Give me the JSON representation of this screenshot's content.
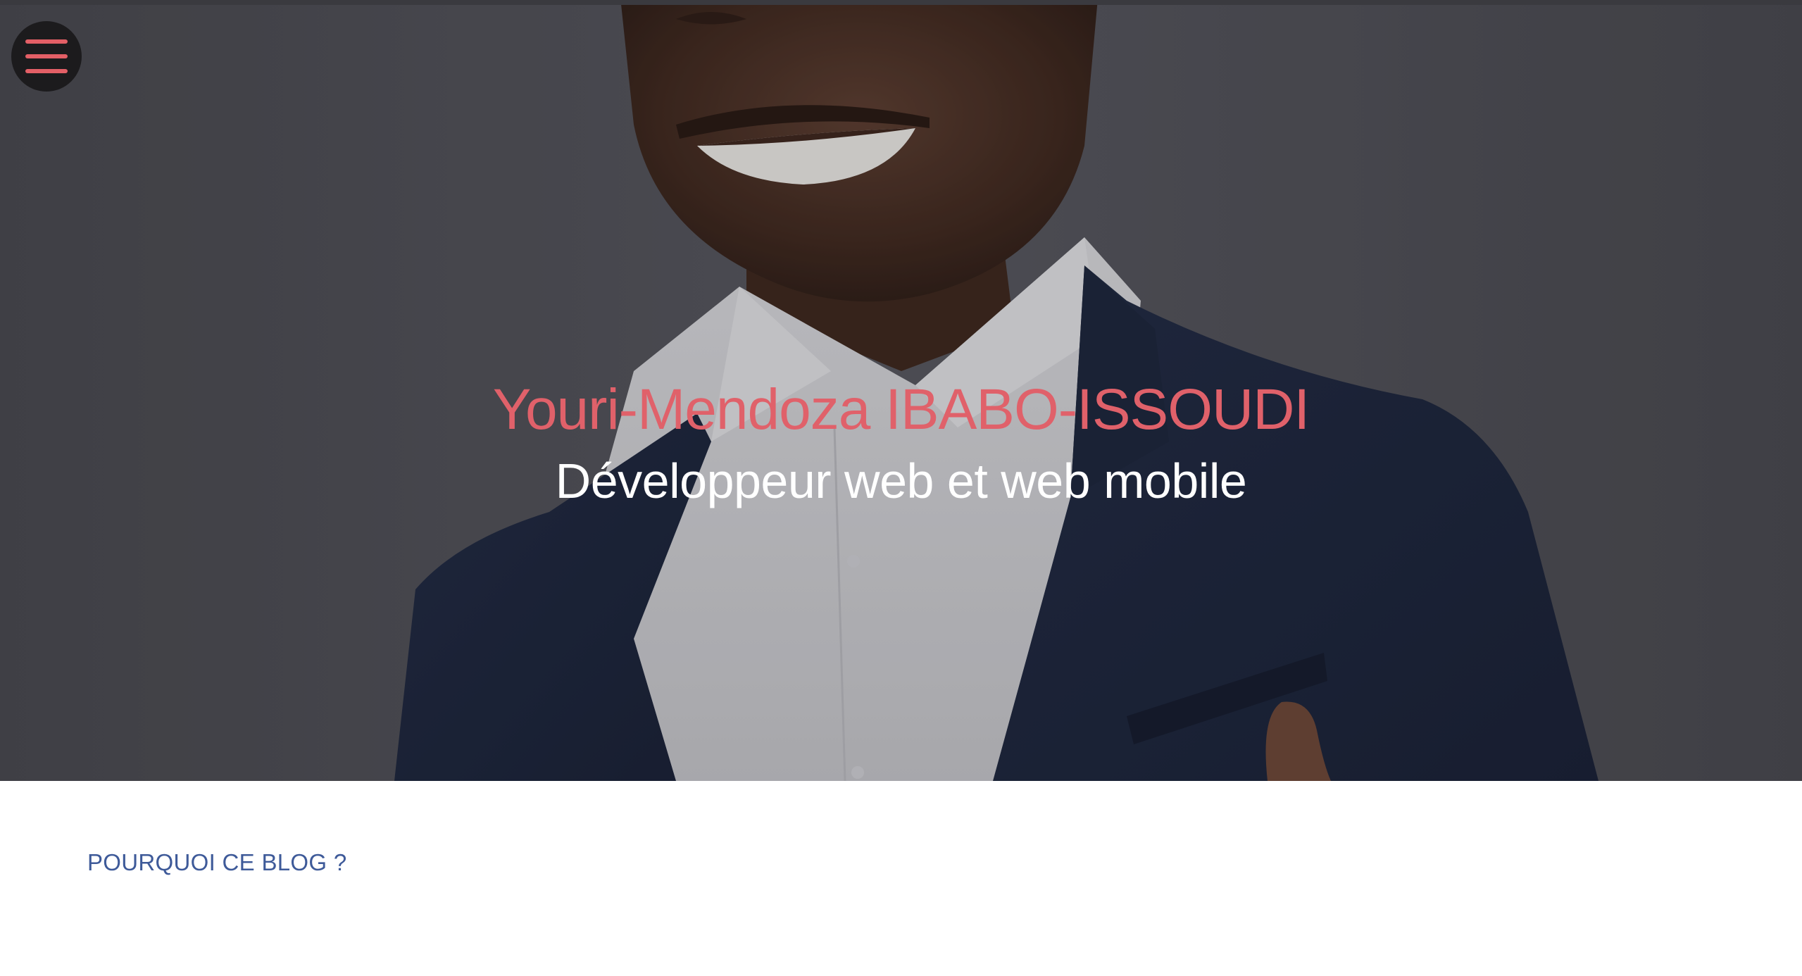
{
  "menu": {
    "icon": "hamburger-icon",
    "color": "#e35f66"
  },
  "hero": {
    "name": "Youri-Mendoza IBABO-ISSOUDI",
    "subtitle": "Développeur web et web mobile",
    "name_color": "#e0616a",
    "subtitle_color": "#ffffff"
  },
  "main": {
    "section_heading": "POURQUOI CE BLOG ?",
    "heading_color": "#3e5a99"
  }
}
